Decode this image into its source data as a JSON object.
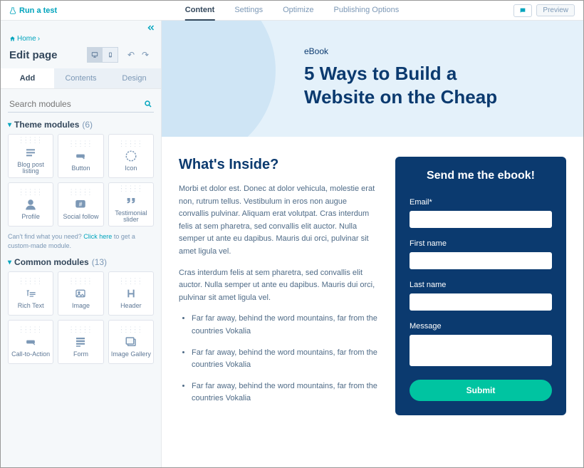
{
  "topbar": {
    "run_test": "Run a test",
    "tabs": [
      "Content",
      "Settings",
      "Optimize",
      "Publishing Options"
    ],
    "preview": "Preview"
  },
  "sidebar": {
    "breadcrumb_home": "Home",
    "title": "Edit page",
    "panel_tabs": [
      "Add",
      "Contents",
      "Design"
    ],
    "search_placeholder": "Search modules",
    "theme_head": "Theme modules",
    "theme_count": "(6)",
    "theme_modules": [
      {
        "label": "Blog post listing",
        "icon": "list"
      },
      {
        "label": "Button",
        "icon": "button"
      },
      {
        "label": "Icon",
        "icon": "icon"
      },
      {
        "label": "Profile",
        "icon": "profile"
      },
      {
        "label": "Social follow",
        "icon": "social"
      },
      {
        "label": "Testimonial slider",
        "icon": "quote"
      }
    ],
    "note_pre": "Can't find what you need? ",
    "note_link": "Click here",
    "note_post": " to get a custom-made module.",
    "common_head": "Common modules",
    "common_count": "(13)",
    "common_modules": [
      {
        "label": "Rich Text",
        "icon": "richtext"
      },
      {
        "label": "Image",
        "icon": "image"
      },
      {
        "label": "Header",
        "icon": "header"
      },
      {
        "label": "Call-to-Action",
        "icon": "cta"
      },
      {
        "label": "Form",
        "icon": "form"
      },
      {
        "label": "Image Gallery",
        "icon": "gallery"
      }
    ]
  },
  "page": {
    "eyebrow": "eBook",
    "title_line1": "5 Ways to Build a",
    "title_line2": "Website on the Cheap",
    "h2": "What's Inside?",
    "p1": "Morbi et dolor est. Donec at dolor vehicula, molestie erat non, rutrum tellus. Vestibulum in eros non augue convallis pulvinar. Aliquam erat volutpat. Cras interdum felis at sem pharetra, sed convallis elit auctor. Nulla semper ut ante eu dapibus. Mauris dui orci, pulvinar sit amet ligula vel.",
    "p2": "Cras interdum felis at sem pharetra, sed convallis elit auctor. Nulla semper ut ante eu dapibus. Mauris dui orci, pulvinar sit amet ligula vel.",
    "bullets": [
      "Far far away, behind the word mountains, far from the countries Vokalia",
      "Far far away, behind the word mountains, far from the countries Vokalia",
      "Far far away, behind the word mountains, far from the countries Vokalia"
    ],
    "form": {
      "title": "Send me the ebook!",
      "email": "Email*",
      "first": "First name",
      "last": "Last name",
      "message": "Message",
      "submit": "Submit"
    }
  }
}
